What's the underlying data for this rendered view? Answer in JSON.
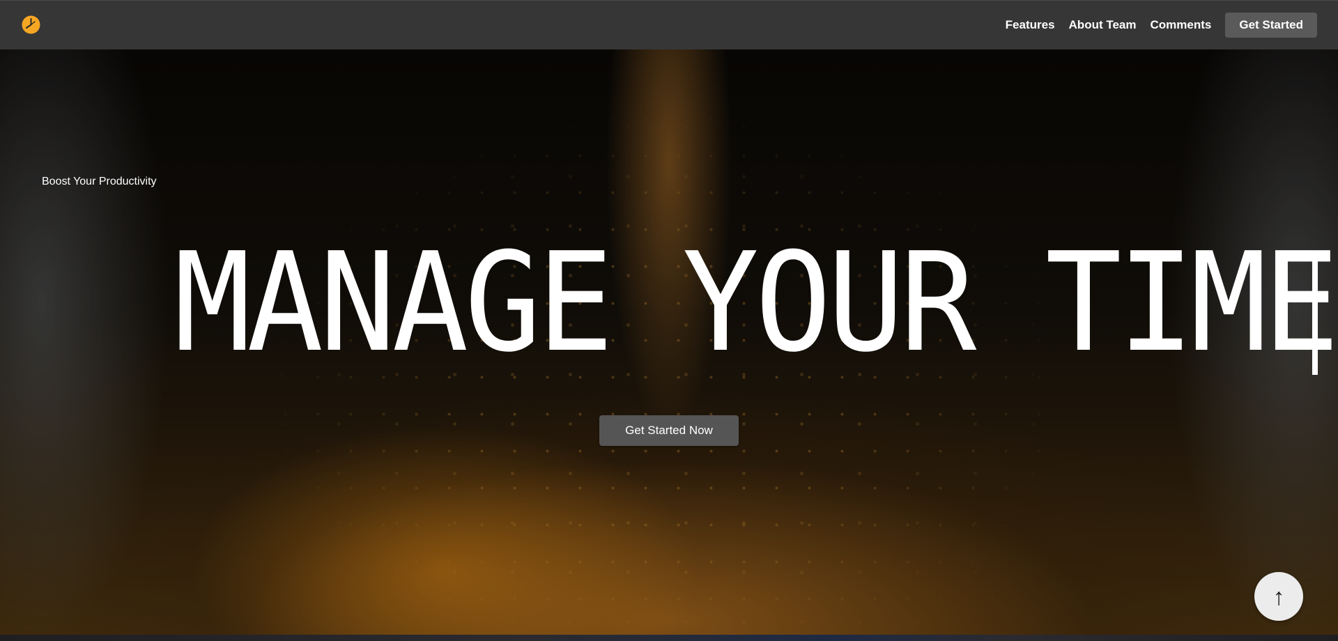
{
  "header": {
    "logo_icon": "clock-icon",
    "logo_color": "#f5a623",
    "nav": [
      {
        "label": "Features"
      },
      {
        "label": "About Team"
      },
      {
        "label": "Comments"
      }
    ],
    "cta_label": "Get Started"
  },
  "hero": {
    "eyebrow": "Boost Your Productivity",
    "headline": "MANAGE YOUR TIME",
    "cta_label": "Get Started Now",
    "background_description_colors": [
      "#0a0806",
      "#4a3210",
      "#e08c14"
    ]
  },
  "back_to_top": {
    "icon": "arrow-up-icon",
    "glyph": "↑"
  }
}
